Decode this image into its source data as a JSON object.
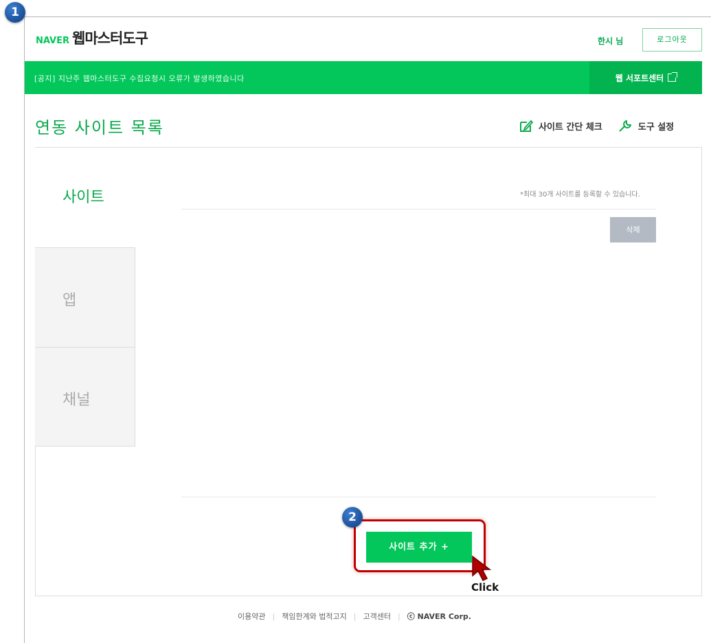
{
  "steps": {
    "one": "1",
    "two": "2"
  },
  "header": {
    "logo_brand": "NAVER",
    "logo_title": "웹마스터도구",
    "username": "한시 님",
    "logout_label": "로그아웃"
  },
  "notice": {
    "text": "[공지] 지난주 웹마스터도구 수집요청시 오류가 발생하였습니다",
    "support_label": "웹 서포트센터"
  },
  "page": {
    "title": "연동 사이트 목록",
    "actions": {
      "site_check": "사이트 간단 체크",
      "tool_settings": "도구 설정"
    }
  },
  "tabs": [
    {
      "label": "사이트",
      "active": true
    },
    {
      "label": "앱",
      "active": false
    },
    {
      "label": "채널",
      "active": false
    }
  ],
  "content": {
    "limit_note": "*최대 30개 사이트를 등록할 수 있습니다.",
    "delete_label": "삭제",
    "add_label": "사이트 추가 +"
  },
  "annotation": {
    "click_label": "Click"
  },
  "footer": {
    "links": [
      "이용약관",
      "책임한계와 법적고지",
      "고객센터"
    ],
    "copyright": "ⓒ NAVER Corp."
  },
  "colors": {
    "brand_green": "#03c75a",
    "highlight_red": "#c00000",
    "badge_blue": "#1c4f98"
  }
}
